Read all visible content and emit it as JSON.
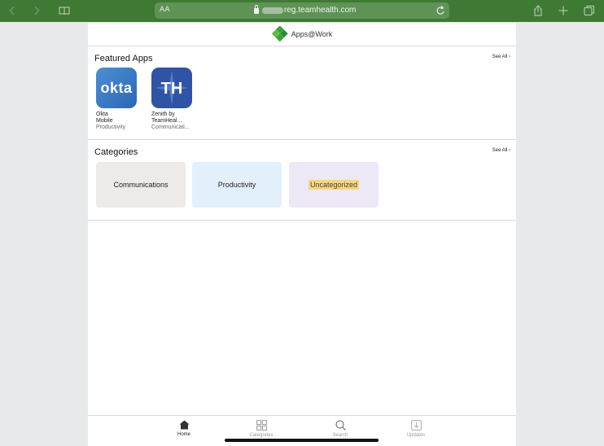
{
  "browser": {
    "text_size_label": "AA",
    "url": "reg.teamhealth.com",
    "back_icon": "chevron-left-icon",
    "forward_icon": "chevron-right-icon",
    "bookmarks_icon": "book-icon",
    "share_icon": "share-icon",
    "new_tab_icon": "plus-icon",
    "tabs_icon": "tabs-icon",
    "reload_icon": "reload-icon"
  },
  "header": {
    "brand": "Apps@Work"
  },
  "featured": {
    "title": "Featured Apps",
    "see_all": "See All",
    "apps": [
      {
        "icon_text": "okta",
        "name_line1": "Okta",
        "name_line2": "Mobile",
        "category": "Productivity"
      },
      {
        "icon_text": "TH",
        "name_line1": "Zenith by",
        "name_line2": "TeamHeal...",
        "category": "Communicati..."
      }
    ]
  },
  "categories": {
    "title": "Categories",
    "see_all": "See All",
    "items": [
      "Communications",
      "Productivity",
      "Uncategorized"
    ]
  },
  "tabbar": {
    "tabs": [
      {
        "label": "Home",
        "icon": "house-icon",
        "active": true
      },
      {
        "label": "Categories",
        "icon": "grid-icon",
        "active": false
      },
      {
        "label": "Search",
        "icon": "search-icon",
        "active": false
      },
      {
        "label": "Updates",
        "icon": "download-icon",
        "active": false
      }
    ]
  },
  "colors": {
    "toolbar": "#3e7a33",
    "brand_green": "#3aa33a",
    "okta_blue": "#3d7fcc",
    "th_blue": "#2f54a6",
    "highlight": "#f6d77a"
  }
}
